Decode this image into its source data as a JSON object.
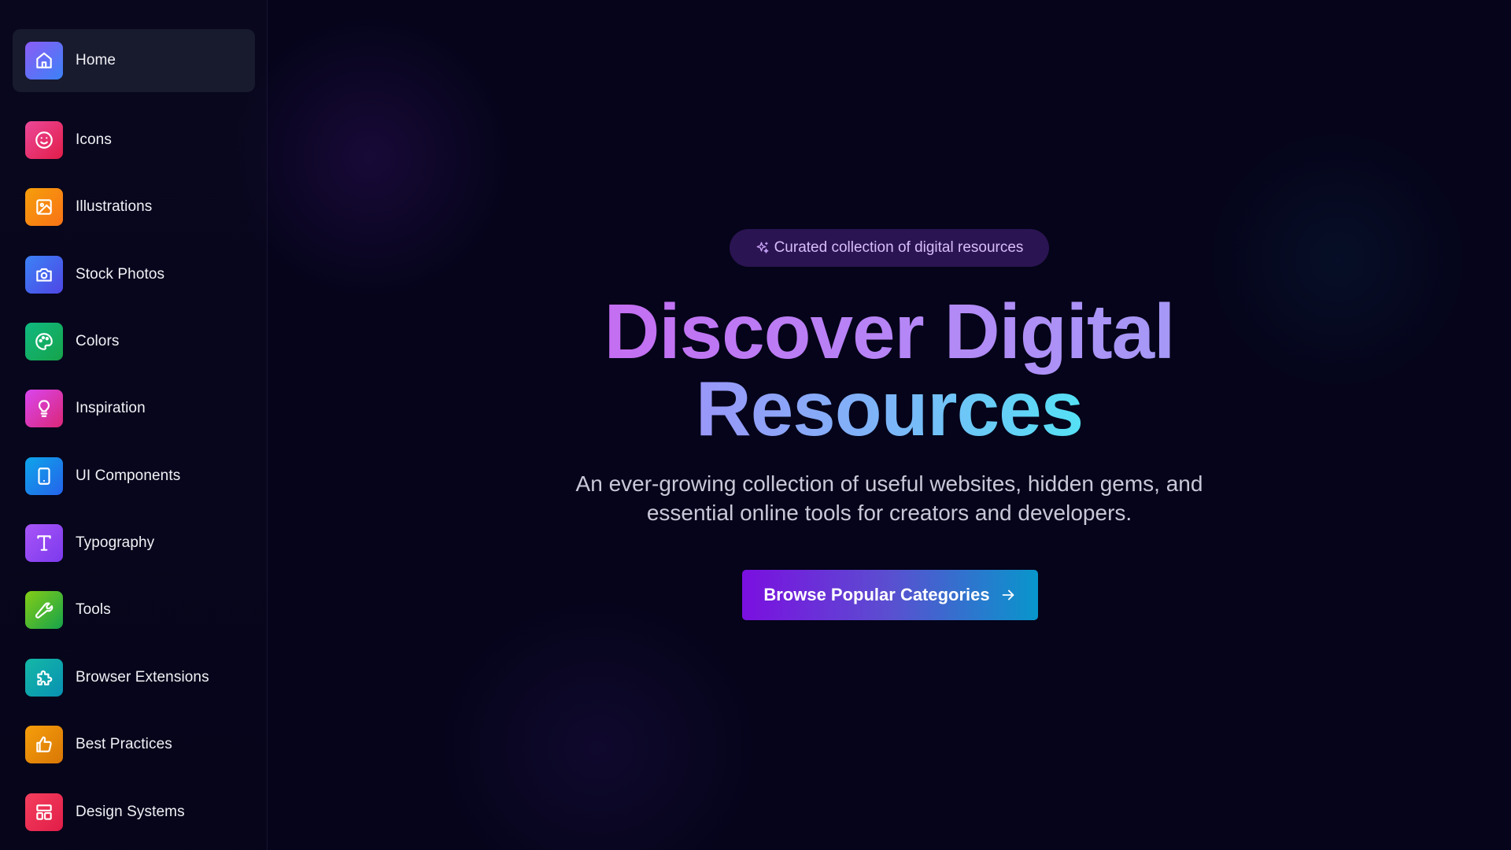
{
  "sidebar": {
    "items": [
      {
        "label": "Home",
        "icon": "home-icon",
        "color_from": "#8b5cf6",
        "color_to": "#3b82f6",
        "active": true
      },
      {
        "label": "Icons",
        "icon": "smiley-icon",
        "color_from": "#ec4899",
        "color_to": "#e11d48"
      },
      {
        "label": "Illustrations",
        "icon": "image-icon",
        "color_from": "#f59e0b",
        "color_to": "#f97316"
      },
      {
        "label": "Stock Photos",
        "icon": "camera-icon",
        "color_from": "#3b82f6",
        "color_to": "#4f46e5"
      },
      {
        "label": "Colors",
        "icon": "palette-icon",
        "color_from": "#10b981",
        "color_to": "#16a34a"
      },
      {
        "label": "Inspiration",
        "icon": "lightbulb-icon",
        "color_from": "#d946ef",
        "color_to": "#db2777"
      },
      {
        "label": "UI Components",
        "icon": "tablet-icon",
        "color_from": "#0ea5e9",
        "color_to": "#2563eb"
      },
      {
        "label": "Typography",
        "icon": "text-icon",
        "color_from": "#a855f7",
        "color_to": "#7c3aed"
      },
      {
        "label": "Tools",
        "icon": "wrench-icon",
        "color_from": "#84cc16",
        "color_to": "#16a34a"
      },
      {
        "label": "Browser Extensions",
        "icon": "puzzle-icon",
        "color_from": "#14b8a6",
        "color_to": "#0891b2"
      },
      {
        "label": "Best Practices",
        "icon": "thumbs-up-icon",
        "color_from": "#f59e0b",
        "color_to": "#d97706"
      },
      {
        "label": "Design Systems",
        "icon": "layout-icon",
        "color_from": "#f43f5e",
        "color_to": "#e11d48"
      }
    ]
  },
  "hero": {
    "badge_text": "Curated collection of digital resources",
    "badge_icon": "sparkles-icon",
    "title_line1": "Discover Digital",
    "title_line2": "Resources",
    "subtitle": "An ever-growing collection of useful websites, hidden gems, and essential online tools for creators and developers.",
    "cta_label": "Browse Popular Categories",
    "cta_icon": "arrow-right-icon"
  }
}
